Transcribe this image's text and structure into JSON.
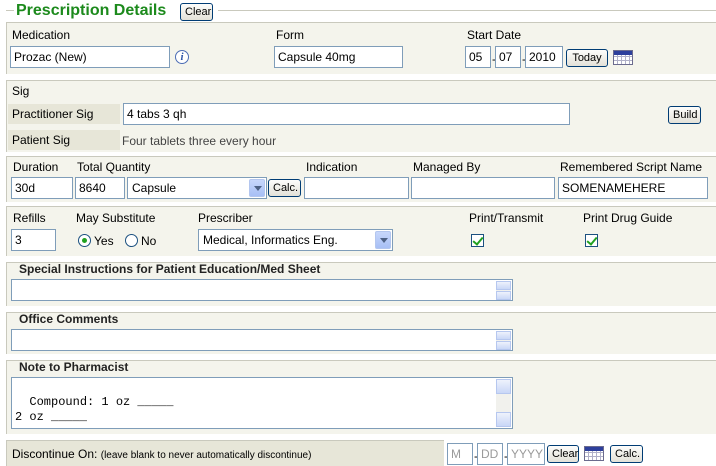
{
  "header": {
    "title": "Prescription Details",
    "clear_label": "Clear"
  },
  "medication": {
    "label": "Medication",
    "value": "Prozac (New)",
    "info_icon": "i"
  },
  "form": {
    "label": "Form",
    "value": "Capsule 40mg"
  },
  "start_date": {
    "label": "Start Date",
    "month": "05",
    "day": "07",
    "year": "2010",
    "today_label": "Today"
  },
  "sig": {
    "title": "Sig",
    "practitioner_label": "Practitioner Sig",
    "practitioner_value": "4 tabs 3 qh",
    "build_label": "Build",
    "patient_label": "Patient Sig",
    "patient_value": "Four tablets three every hour"
  },
  "quantity": {
    "duration_label": "Duration",
    "duration_value": "30d",
    "total_label": "Total Quantity",
    "total_value": "8640",
    "unit_value": "Capsule",
    "calc_label": "Calc.",
    "indication_label": "Indication",
    "indication_value": "",
    "managed_label": "Managed By",
    "managed_value": "",
    "remembered_label": "Remembered Script Name",
    "remembered_value": "SOMENAMEHERE"
  },
  "refills": {
    "refills_label": "Refills",
    "refills_value": "3",
    "substitute_label": "May Substitute",
    "yes_label": "Yes",
    "no_label": "No",
    "substitute_selected": "Yes",
    "prescriber_label": "Prescriber",
    "prescriber_value": "Medical, Informatics Eng.",
    "print_label": "Print/Transmit",
    "print_checked": true,
    "guide_label": "Print Drug Guide",
    "guide_checked": true
  },
  "special": {
    "title": "Special Instructions for Patient Education/Med Sheet",
    "value": ""
  },
  "office": {
    "title": "Office Comments",
    "value": ""
  },
  "pharmacist": {
    "title": "Note to Pharmacist",
    "value": "Compound: 1 oz _____\n2 oz _____"
  },
  "discontinue": {
    "label": "Discontinue On:",
    "note": "(leave blank to never automatically discontinue)",
    "month_placeholder": "M",
    "day_placeholder": "DD",
    "year_placeholder": "YYYY",
    "clear_label": "Clear",
    "calc_label": "Calc."
  },
  "colors": {
    "title_green": "#1c8a1c",
    "panel_bg": "#f4f4ec",
    "label_bg": "#e7e6d8"
  }
}
